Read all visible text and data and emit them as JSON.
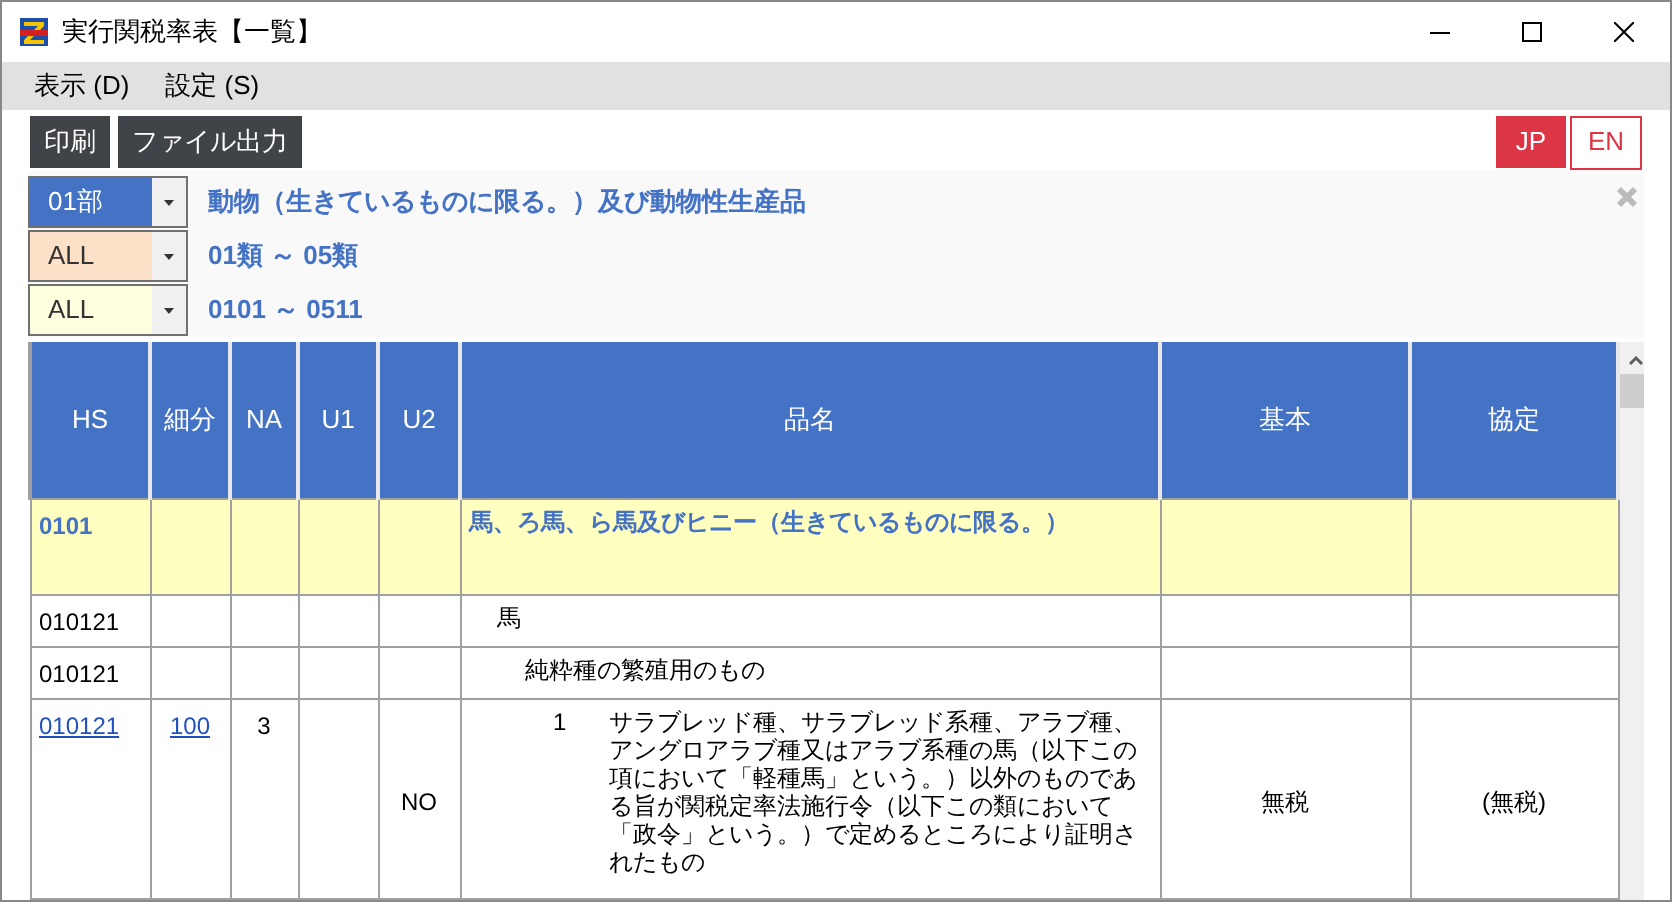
{
  "window": {
    "title": "実行関税率表【一覧】"
  },
  "menu": [
    "表示 (D)",
    "設定 (S)"
  ],
  "toolbar": [
    "印刷",
    "ファイル出力"
  ],
  "languages": [
    {
      "label": "JP",
      "selected": true
    },
    {
      "label": "EN",
      "selected": false
    }
  ],
  "filters": [
    {
      "value": "01部",
      "color": "#4472c4",
      "description": "動物（生きているものに限る。）及び動物性生産品"
    },
    {
      "value": "ALL",
      "color": "#fde0c8",
      "description": "01類 ～ 05類"
    },
    {
      "value": "ALL",
      "color": "#ffffe0",
      "description": "0101 ～ 0511"
    }
  ],
  "table": {
    "columns": [
      "HS",
      "細分",
      "NA",
      "U1",
      "U2",
      "品名",
      "基本",
      "協定"
    ],
    "rows": [
      {
        "kind": "heading",
        "hs": "0101",
        "name": "馬、ろ馬、ら馬及びヒニー（生きているものに限る。）",
        "children": [
          {
            "kind": "plain",
            "hs": "010121",
            "name": "馬",
            "children": [
              {
                "kind": "plain",
                "hs": "010121",
                "name": "純粋種の繁殖用のもの",
                "children": [
                  {
                    "kind": "item",
                    "hs": "010121",
                    "sub": "100",
                    "na": "3",
                    "u2": "NO",
                    "number": "1",
                    "name": "サラブレッド種、サラブレッド系種、アラブ種、アングロアラブ種又はアラブ系種の馬（以下この項において「軽種馬」という。）以外のものである旨が関税定率法施行令（以下この類において「政令」という。）で定めるところにより証明されたもの",
                    "basic": "無税",
                    "agreement": "(無税)"
                  }
                ]
              }
            ]
          }
        ]
      }
    ]
  }
}
